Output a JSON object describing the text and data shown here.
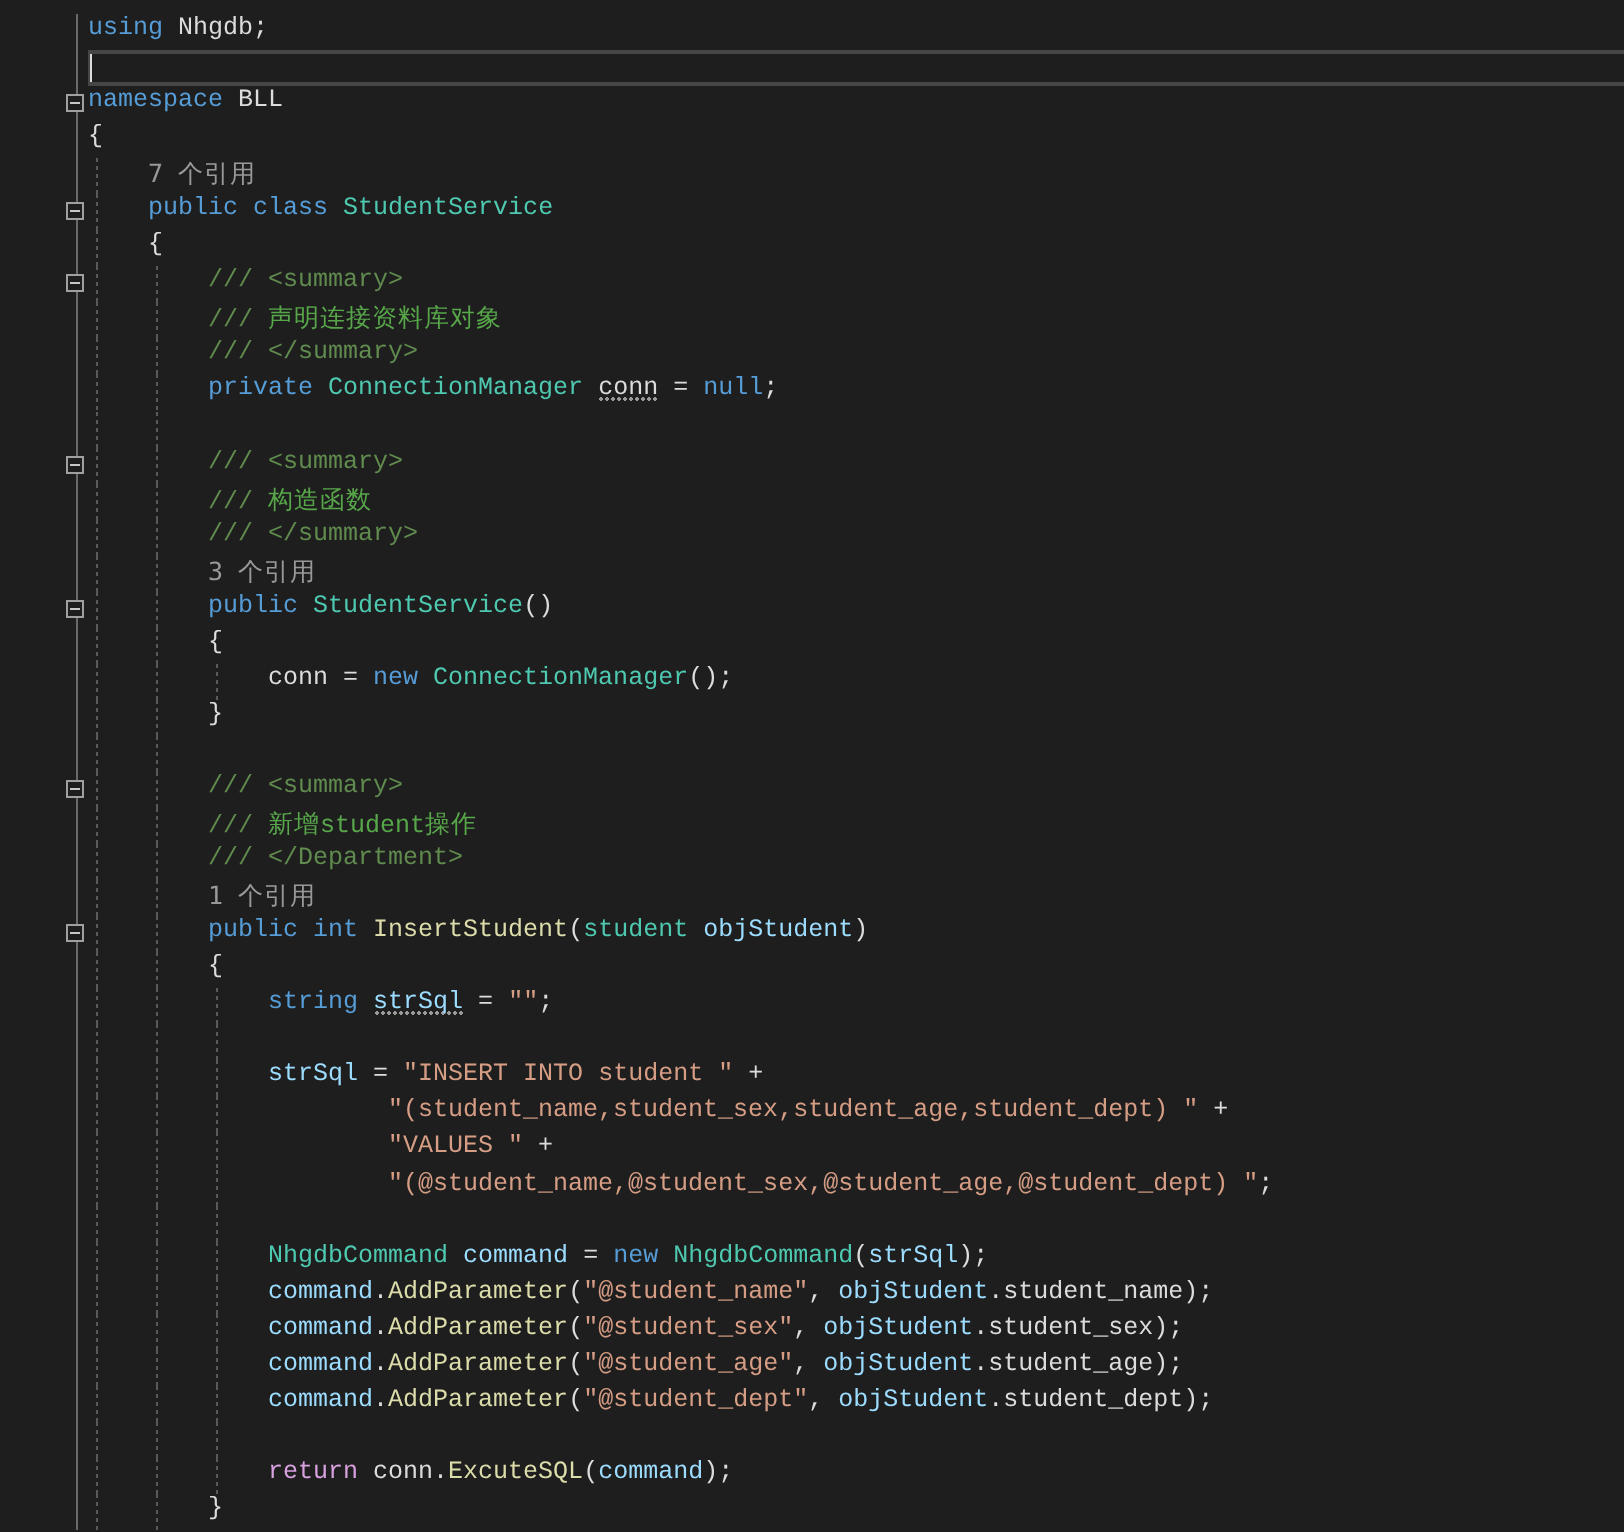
{
  "editor": {
    "lines": [
      {
        "tokens": [
          {
            "t": "using",
            "kind": "kw"
          },
          {
            "t": " Nhgdb;",
            "kind": "plain"
          }
        ]
      },
      {
        "current": true
      },
      {
        "expanded": true,
        "tokens": [
          {
            "t": "namespace",
            "kind": "kw"
          },
          {
            "t": " BLL",
            "kind": "plain"
          }
        ]
      },
      {
        "tokens": [
          {
            "t": "{",
            "kind": "plain"
          }
        ]
      },
      {
        "tokens": [
          {
            "t": "    7 个引用",
            "kind": "lens"
          }
        ]
      },
      {
        "expanded": true,
        "tokens": [
          {
            "t": "    public class ",
            "kind": "kw"
          },
          {
            "t": "StudentService",
            "kind": "type"
          }
        ]
      },
      {
        "tokens": [
          {
            "t": "    {",
            "kind": "plain"
          }
        ]
      },
      {
        "expanded": true,
        "tokens": [
          {
            "t": "        /// <summary>",
            "kind": "doc"
          }
        ]
      },
      {
        "tokens": [
          {
            "t": "        ///",
            "kind": "doc"
          },
          {
            "t": " 声明连接资料库对象",
            "kind": "comment"
          }
        ]
      },
      {
        "tokens": [
          {
            "t": "        /// </summary>",
            "kind": "doc"
          }
        ]
      },
      {
        "tokens": [
          {
            "t": "        private ",
            "kind": "kw"
          },
          {
            "t": "ConnectionManager ",
            "kind": "type"
          },
          {
            "t": "conn",
            "kind": "plain",
            "suggestion": true
          },
          {
            "t": " = ",
            "kind": "plain"
          },
          {
            "t": "null",
            "kind": "kw"
          },
          {
            "t": ";",
            "kind": "plain"
          }
        ]
      },
      {
        "blank_before": true,
        "expanded": true,
        "tokens": [
          {
            "t": "        /// <summary>",
            "kind": "doc"
          }
        ]
      },
      {
        "tokens": [
          {
            "t": "        ///",
            "kind": "doc"
          },
          {
            "t": " 构造函数",
            "kind": "comment"
          }
        ]
      },
      {
        "tokens": [
          {
            "t": "        /// </summary>",
            "kind": "doc"
          }
        ]
      },
      {
        "tokens": [
          {
            "t": "        3 个引用",
            "kind": "lens"
          }
        ]
      },
      {
        "expanded": true,
        "tokens": [
          {
            "t": "        public ",
            "kind": "kw"
          },
          {
            "t": "StudentService",
            "kind": "type"
          },
          {
            "t": "()",
            "kind": "plain"
          }
        ]
      },
      {
        "tokens": [
          {
            "t": "        {",
            "kind": "plain"
          }
        ]
      },
      {
        "tokens": [
          {
            "t": "            conn = ",
            "kind": "plain"
          },
          {
            "t": "new ",
            "kind": "kw"
          },
          {
            "t": "ConnectionManager",
            "kind": "type"
          },
          {
            "t": "();",
            "kind": "plain"
          }
        ]
      },
      {
        "tokens": [
          {
            "t": "        }",
            "kind": "plain"
          }
        ]
      },
      {
        "blank_before": true,
        "expanded": true,
        "tokens": [
          {
            "t": "        /// <summary>",
            "kind": "doc"
          }
        ]
      },
      {
        "tokens": [
          {
            "t": "        ///",
            "kind": "doc"
          },
          {
            "t": " 新增student操作",
            "kind": "comment"
          }
        ]
      },
      {
        "tokens": [
          {
            "t": "        /// </Department>",
            "kind": "doc"
          }
        ]
      },
      {
        "tokens": [
          {
            "t": "        1 个引用",
            "kind": "lens"
          }
        ]
      },
      {
        "expanded": true,
        "tokens": [
          {
            "t": "        public int ",
            "kind": "kw"
          },
          {
            "t": "InsertStudent",
            "kind": "method"
          },
          {
            "t": "(",
            "kind": "plain"
          },
          {
            "t": "student ",
            "kind": "type"
          },
          {
            "t": "objStudent",
            "kind": "var"
          },
          {
            "t": ")",
            "kind": "plain"
          }
        ]
      },
      {
        "tokens": [
          {
            "t": "        {",
            "kind": "plain"
          }
        ]
      },
      {
        "tokens": [
          {
            "t": "            string ",
            "kind": "kw"
          },
          {
            "t": "strSql",
            "kind": "var",
            "suggestion": true
          },
          {
            "t": " = ",
            "kind": "plain"
          },
          {
            "t": "\"\"",
            "kind": "str"
          },
          {
            "t": ";",
            "kind": "plain"
          }
        ]
      },
      {
        "blank_before": true,
        "tokens": [
          {
            "t": "            strSql",
            "kind": "var"
          },
          {
            "t": " = ",
            "kind": "plain"
          },
          {
            "t": "\"INSERT INTO student \"",
            "kind": "str"
          },
          {
            "t": " +",
            "kind": "plain"
          }
        ]
      },
      {
        "tokens": [
          {
            "t": "                    \"(student_name,student_sex,student_age,student_dept) \"",
            "kind": "str"
          },
          {
            "t": " +",
            "kind": "plain"
          }
        ]
      },
      {
        "tokens": [
          {
            "t": "                    \"VALUES \"",
            "kind": "str"
          },
          {
            "t": " +",
            "kind": "plain"
          }
        ]
      },
      {
        "tokens": [
          {
            "t": "                    \"(@student_name,@student_sex,@student_age,@student_dept) \"",
            "kind": "str"
          },
          {
            "t": ";",
            "kind": "plain"
          }
        ]
      },
      {
        "blank_before": true,
        "tokens": [
          {
            "t": "            NhgdbCommand ",
            "kind": "type"
          },
          {
            "t": "command",
            "kind": "var"
          },
          {
            "t": " = ",
            "kind": "plain"
          },
          {
            "t": "new ",
            "kind": "kw"
          },
          {
            "t": "NhgdbCommand",
            "kind": "type"
          },
          {
            "t": "(",
            "kind": "plain"
          },
          {
            "t": "strSql",
            "kind": "var"
          },
          {
            "t": ");",
            "kind": "plain"
          }
        ]
      },
      {
        "tokens": [
          {
            "t": "            command",
            "kind": "var"
          },
          {
            "t": ".",
            "kind": "plain"
          },
          {
            "t": "AddParameter",
            "kind": "method"
          },
          {
            "t": "(",
            "kind": "plain"
          },
          {
            "t": "\"@student_name\"",
            "kind": "str"
          },
          {
            "t": ", ",
            "kind": "plain"
          },
          {
            "t": "objStudent",
            "kind": "var"
          },
          {
            "t": ".student_name);",
            "kind": "plain"
          }
        ]
      },
      {
        "tokens": [
          {
            "t": "            command",
            "kind": "var"
          },
          {
            "t": ".",
            "kind": "plain"
          },
          {
            "t": "AddParameter",
            "kind": "method"
          },
          {
            "t": "(",
            "kind": "plain"
          },
          {
            "t": "\"@student_sex\"",
            "kind": "str"
          },
          {
            "t": ", ",
            "kind": "plain"
          },
          {
            "t": "objStudent",
            "kind": "var"
          },
          {
            "t": ".student_sex);",
            "kind": "plain"
          }
        ]
      },
      {
        "tokens": [
          {
            "t": "            command",
            "kind": "var"
          },
          {
            "t": ".",
            "kind": "plain"
          },
          {
            "t": "AddParameter",
            "kind": "method"
          },
          {
            "t": "(",
            "kind": "plain"
          },
          {
            "t": "\"@student_age\"",
            "kind": "str"
          },
          {
            "t": ", ",
            "kind": "plain"
          },
          {
            "t": "objStudent",
            "kind": "var"
          },
          {
            "t": ".student_age);",
            "kind": "plain"
          }
        ]
      },
      {
        "tokens": [
          {
            "t": "            command",
            "kind": "var"
          },
          {
            "t": ".",
            "kind": "plain"
          },
          {
            "t": "AddParameter",
            "kind": "method"
          },
          {
            "t": "(",
            "kind": "plain"
          },
          {
            "t": "\"@student_dept\"",
            "kind": "str"
          },
          {
            "t": ", ",
            "kind": "plain"
          },
          {
            "t": "objStudent",
            "kind": "var"
          },
          {
            "t": ".student_dept);",
            "kind": "plain"
          }
        ]
      },
      {
        "blank_before": true,
        "tokens": [
          {
            "t": "            return",
            "kind": "ctrl"
          },
          {
            "t": " conn.",
            "kind": "plain"
          },
          {
            "t": "ExcuteSQL",
            "kind": "method"
          },
          {
            "t": "(",
            "kind": "plain"
          },
          {
            "t": "command",
            "kind": "var"
          },
          {
            "t": ");",
            "kind": "plain"
          }
        ]
      },
      {
        "tokens": [
          {
            "t": "        }",
            "kind": "plain"
          }
        ]
      }
    ]
  }
}
